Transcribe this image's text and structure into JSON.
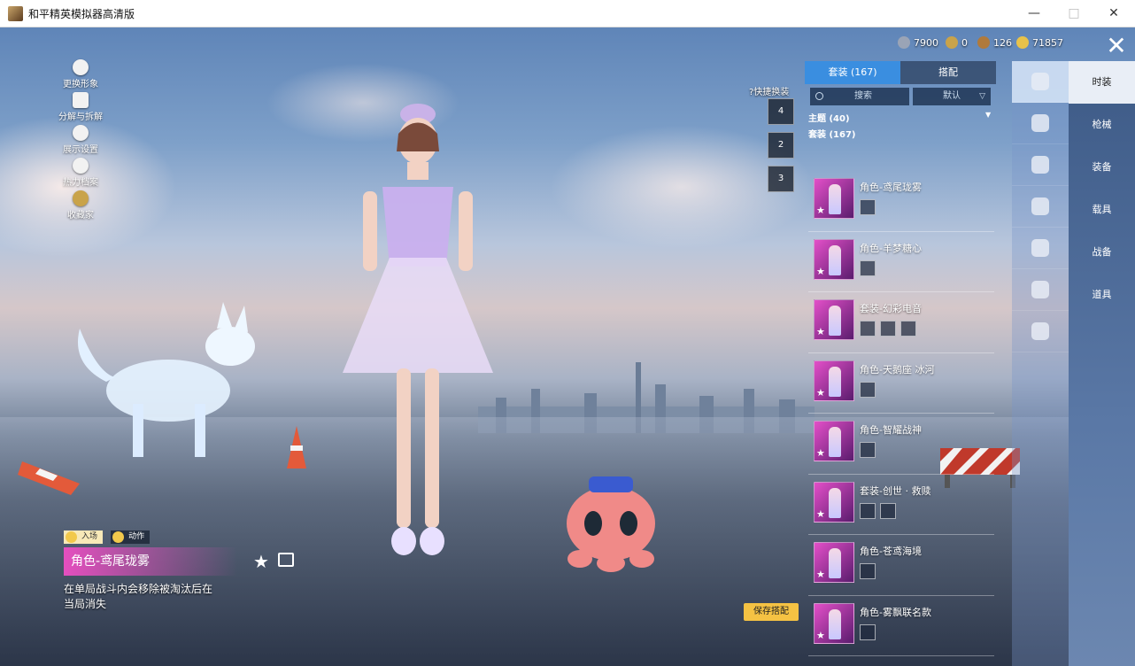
{
  "window": {
    "title": "和平精英模拟器高清版",
    "minimize": "—",
    "maximize": "□",
    "close": "✕"
  },
  "left_menu": [
    {
      "label": "更换形象",
      "icon": "avatar-icon"
    },
    {
      "label": "分解与拆解",
      "icon": "puzzle-icon"
    },
    {
      "label": "展示设置",
      "icon": "eye-icon"
    },
    {
      "label": "热力档案",
      "icon": "flame-icon"
    },
    {
      "label": "收藏家",
      "icon": "collector-badge-icon"
    }
  ],
  "currency": [
    {
      "value": "7900",
      "icon": "silver-coin-icon",
      "color": "#9aa4b6"
    },
    {
      "value": "0",
      "icon": "gold-badge-icon",
      "color": "#c9a34a"
    },
    {
      "value": "126",
      "icon": "bronze-coin-icon",
      "color": "#b07a3c"
    },
    {
      "value": "71857",
      "icon": "gold-coin-icon",
      "color": "#e8c24a"
    }
  ],
  "close_label": "✕",
  "quick_switch": {
    "label": "?快捷换装",
    "slots": [
      "4",
      "2",
      "3"
    ]
  },
  "panel": {
    "tabs": [
      "套装 (167)",
      "搭配"
    ],
    "search_placeholder": "搜索",
    "sort_label": "默认",
    "theme_label": "主题 (40)",
    "suit_label": "套装 (167)",
    "items": [
      {
        "name": "角色-鸢尾珑雾",
        "subs": 1
      },
      {
        "name": "角色-羊梦糖心",
        "subs": 1
      },
      {
        "name": "套装-幻彩电音",
        "subs": 3
      },
      {
        "name": "角色-天鹅座 冰河",
        "subs": 1
      },
      {
        "name": "角色-智耀战神",
        "subs": 1
      },
      {
        "name": "套装-创世 · 救赎",
        "subs": 2
      },
      {
        "name": "角色-苍鸢海境",
        "subs": 1
      },
      {
        "name": "角色-雾飘联名款",
        "subs": 1
      }
    ]
  },
  "category_icons": [
    "character-icon",
    "cap-icon",
    "goggles-icon",
    "mask-icon",
    "figure-icon",
    "pants-icon",
    "shoes-icon"
  ],
  "side_nav": [
    "时装",
    "枪械",
    "装备",
    "载具",
    "战备",
    "道具"
  ],
  "intro": {
    "tabs": [
      "入场",
      "动作"
    ],
    "name": "角色-鸢尾珑雾",
    "description": "在单局战斗内会移除被淘汰后在当局消失"
  },
  "save_button": "保存搭配",
  "colors": {
    "accent": "#3a8ee0",
    "highlight": "#e54fbf",
    "save": "#f5c243"
  }
}
